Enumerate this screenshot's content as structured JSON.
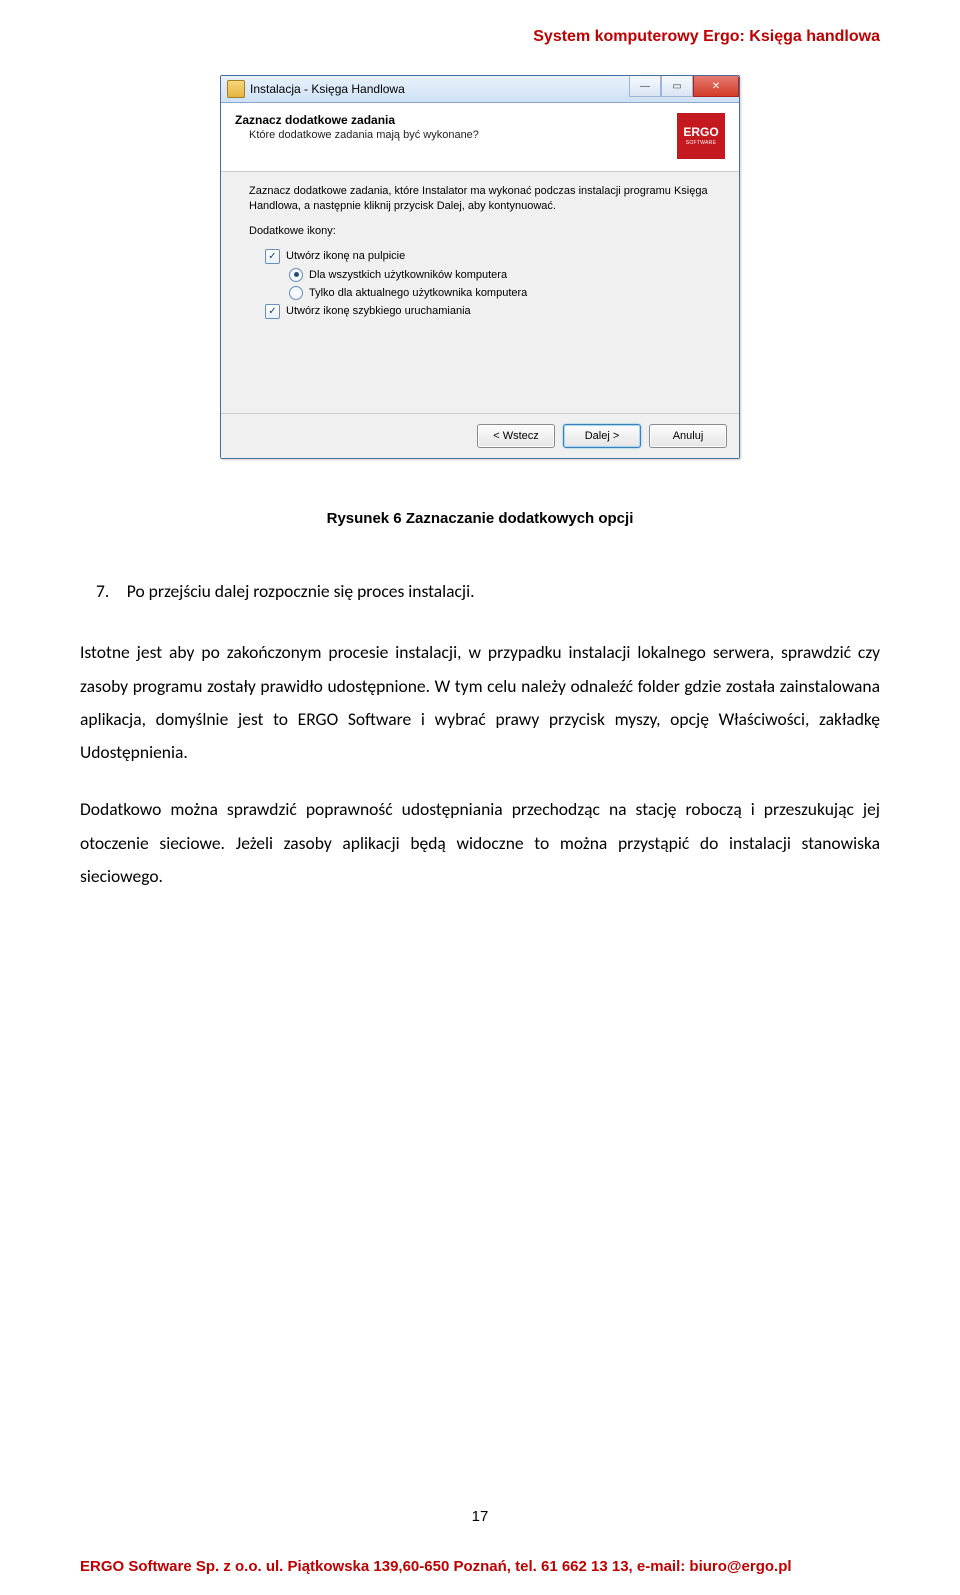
{
  "header": {
    "text": "System komputerowy Ergo: Księga handlowa"
  },
  "footer": {
    "text": "ERGO Software Sp. z o.o. ul. Piątkowska 139,60-650 Poznań, tel. 61 662 13 13, e-mail: biuro@ergo.pl"
  },
  "page_number": "17",
  "screenshot": {
    "window_title": "Instalacja - Księga Handlowa",
    "header_title": "Zaznacz dodatkowe zadania",
    "header_sub": "Które dodatkowe zadania mają być wykonane?",
    "logo_text": "ERGO",
    "logo_sub": "SOFTWARE",
    "body_intro": "Zaznacz dodatkowe zadania, które Instalator ma wykonać podczas instalacji programu Księga Handlowa, a następnie kliknij przycisk Dalej, aby kontynuować.",
    "section_label": "Dodatkowe ikony:",
    "opt_desktop": "Utwórz ikonę na pulpicie",
    "opt_all_users": "Dla wszystkich użytkowników komputera",
    "opt_current_user": "Tylko dla aktualnego użytkownika komputera",
    "opt_quicklaunch": "Utwórz ikonę szybkiego uruchamiania",
    "btn_back": "< Wstecz",
    "btn_next": "Dalej >",
    "btn_cancel": "Anuluj"
  },
  "caption": "Rysunek 6  Zaznaczanie dodatkowych opcji",
  "doc": {
    "item7": "7. Po przejściu dalej rozpocznie się proces instalacji.",
    "para1": "Istotne jest aby po zakończonym procesie instalacji, w przypadku instalacji lokalnego serwera, sprawdzić czy zasoby programu zostały prawidło udostępnione. W tym celu należy odnaleźć folder gdzie została zainstalowana aplikacja, domyślnie jest to ERGO Software i  wybrać prawy przycisk myszy, opcję Właściwości, zakładkę Udostępnienia.",
    "para2": "Dodatkowo można sprawdzić poprawność udostępniania przechodząc na stację roboczą i przeszukując jej otoczenie sieciowe. Jeżeli zasoby aplikacji będą widoczne to można przystąpić do instalacji stanowiska sieciowego."
  }
}
